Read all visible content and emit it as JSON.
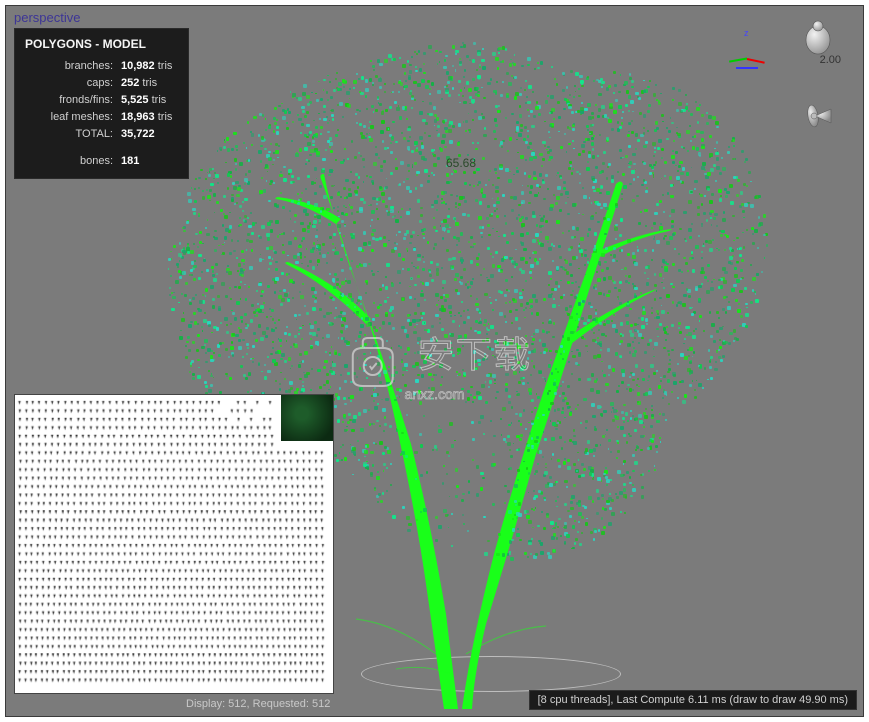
{
  "viewport": {
    "label": "perspective"
  },
  "stats": {
    "title": "POLYGONS - MODEL",
    "rows": [
      {
        "label": "branches:",
        "value": "10,982",
        "unit": "tris"
      },
      {
        "label": "caps:",
        "value": "252",
        "unit": "tris"
      },
      {
        "label": "fronds/fins:",
        "value": "5,525",
        "unit": "tris"
      },
      {
        "label": "leaf meshes:",
        "value": "18,963",
        "unit": "tris"
      },
      {
        "label": "TOTAL:",
        "value": "35,722",
        "unit": ""
      }
    ],
    "bones": {
      "label": "bones:",
      "value": "181"
    }
  },
  "axis": {
    "z": "z"
  },
  "light": {
    "value": "2.00"
  },
  "tree": {
    "height_label": "65.68"
  },
  "watermark": {
    "main": "安下载",
    "sub": "anxz.com"
  },
  "uv_info": {
    "text": "Display: 512, Requested: 512"
  },
  "compute": {
    "text": "[8 cpu threads], Last Compute 6.11 ms (draw to draw 49.90 ms)"
  }
}
